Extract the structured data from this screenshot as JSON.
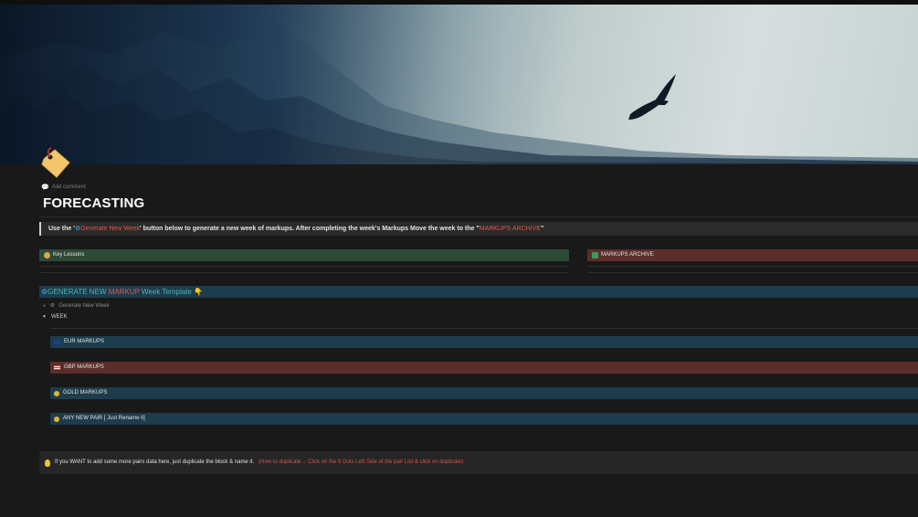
{
  "cover": {
    "description_icon": "eagle-over-misty-forest"
  },
  "page": {
    "icon": "price-tag-icon",
    "add_comment": "Add comment",
    "title": "FORECASTING"
  },
  "callout_top": {
    "prefix": "Use the '",
    "button_name": "Generate New Week",
    "middle": "' button below to generate a new week of markups. After completing the week's Markups  Move the week to the  \"",
    "archive_name": "MARKUPS ARCHIVE",
    "suffix": "\""
  },
  "links": {
    "key_lessons": "Key Lessons",
    "markups_archive": "MARKUPS ARCHIVE"
  },
  "generate_heading": {
    "part1": "GENERATE NEW ",
    "part2": "MARKUP",
    "part3": " Week Template "
  },
  "template_button": {
    "label": "Generate New Week"
  },
  "toggle": {
    "label": "WEEK"
  },
  "pairs": [
    {
      "label": "EUR MARKUPS",
      "icon": "eu-flag-icon",
      "color": "#1d3c4c"
    },
    {
      "label": "GBP MARKUPS",
      "icon": "uk-flag-icon",
      "color": "#5c2e2a"
    },
    {
      "label": "GOLD MARKUPS",
      "icon": "gold-coin-icon",
      "color": "#1d3c4c"
    },
    {
      "label": "ANY NEW PAIR [ Just Rename it]",
      "icon": "gold-coin-icon",
      "color": "#1d3c4c"
    }
  ],
  "callout_bottom": {
    "text": "If you WANT to add some more pairs data here, just duplicate the block & name it.",
    "hint": "(How to duplicate→ Click on the 6 Dots Left Side of the pair List & click on duplicate)"
  },
  "colors": {
    "background": "#191919",
    "red_accent": "#e0574f",
    "blue_accent": "#4fa3d9",
    "green_block": "#2d4a37",
    "red_block": "#5c2e2a",
    "blue_block": "#1d3c4c"
  }
}
